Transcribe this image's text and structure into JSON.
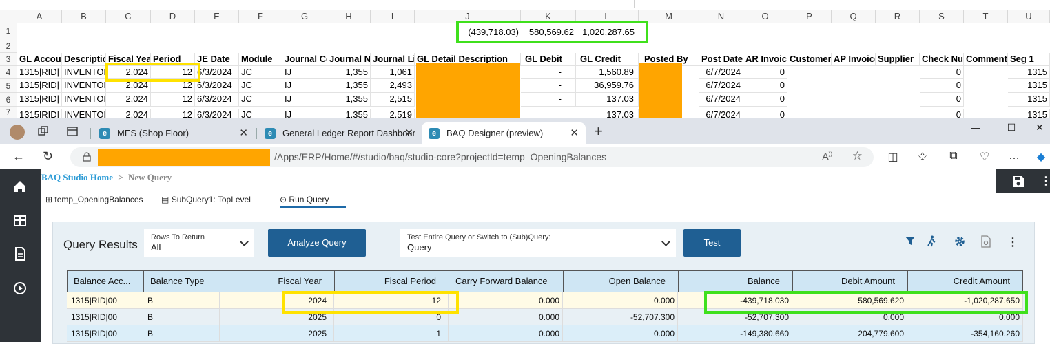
{
  "excel": {
    "columns": [
      "A",
      "B",
      "C",
      "D",
      "E",
      "F",
      "G",
      "H",
      "I",
      "J",
      "K",
      "L",
      "M",
      "N",
      "O",
      "P",
      "Q",
      "R",
      "S",
      "T",
      "U"
    ],
    "rows": [
      "1",
      "2",
      "3",
      "4",
      "5",
      "6",
      "7"
    ],
    "totals": {
      "J": "(439,718.03)",
      "K": "580,569.62",
      "L": "1,020,287.65"
    },
    "headers": [
      "GL Accoun",
      "Descriptio",
      "Fiscal Year",
      "Period",
      "JE Date",
      "Module",
      "Journal Co",
      "Journal Nu",
      "Journal Lin",
      "GL Detail Description",
      "GL Debit",
      "GL Credit",
      "Posted By",
      "Post Date",
      "AR Invoice",
      "Customer",
      "AP Invoice",
      "Supplier",
      "Check Nu",
      "Comment",
      "Seg 1"
    ],
    "data": [
      {
        "a": "1315|RID|",
        "b": "INVENTOR",
        "c": "2,024",
        "d": "12",
        "e": "6/3/2024",
        "f": "JC",
        "g": "IJ",
        "h": "1,355",
        "i": "1,061",
        "k": "-",
        "l": "1,560.89",
        "n": "6/7/2024",
        "o": "0",
        "s": "0",
        "u": "1315"
      },
      {
        "a": "1315|RID|",
        "b": "INVENTOR",
        "c": "2,024",
        "d": "12",
        "e": "6/3/2024",
        "f": "JC",
        "g": "IJ",
        "h": "1,355",
        "i": "2,493",
        "k": "-",
        "l": "36,959.76",
        "n": "6/7/2024",
        "o": "0",
        "s": "0",
        "u": "1315"
      },
      {
        "a": "1315|RID|",
        "b": "INVENTOR",
        "c": "2,024",
        "d": "12",
        "e": "6/3/2024",
        "f": "JC",
        "g": "IJ",
        "h": "1,355",
        "i": "2,515",
        "k": "-",
        "l": "137.03",
        "n": "6/7/2024",
        "o": "0",
        "s": "0",
        "u": "1315"
      },
      {
        "a": "1315|RID|",
        "b": "INVENTOF",
        "c": "2,024",
        "d": "12",
        "e": "6/3/2024",
        "f": "JC",
        "g": "IJ",
        "h": "1,355",
        "i": "2,519",
        "k": "",
        "l": "137.03",
        "n": "6/7/2024",
        "o": "0",
        "s": "0",
        "u": "1315"
      }
    ]
  },
  "browser": {
    "tabs": [
      {
        "label": "MES (Shop Floor)",
        "fav": "e"
      },
      {
        "label": "General Ledger Report Dashboar",
        "fav": "e"
      },
      {
        "label": "BAQ Designer (preview)",
        "fav": "e"
      }
    ],
    "new_tab": "+",
    "url": "/Apps/ERP/Home/#/studio/baq/studio-core?projectId=temp_OpeningBalances"
  },
  "app": {
    "breadcrumb_home": "BAQ Studio Home",
    "breadcrumb_sep": ">",
    "breadcrumb_current": "New Query",
    "subtabs": [
      "temp_OpeningBalances",
      "SubQuery1: TopLevel",
      "Run Query"
    ],
    "panel": {
      "title": "Query Results",
      "rows_label": "Rows To Return",
      "rows_value": "All",
      "analyze": "Analyze Query",
      "test_label": "Test Entire Query or Switch to (Sub)Query:",
      "test_value": "Query",
      "test_btn": "Test"
    },
    "grid": {
      "headers": [
        "Balance Acc...",
        "Balance Type",
        "Fiscal Year",
        "Fiscal Period",
        "Carry Forward Balance",
        "Open Balance",
        "Balance",
        "Debit Amount",
        "Credit Amount"
      ],
      "rows": [
        [
          "1315|RID|00",
          "B",
          "2024",
          "12",
          "0.000",
          "0.000",
          "-439,718.030",
          "580,569.620",
          "-1,020,287.650"
        ],
        [
          "1315|RID|00",
          "B",
          "2025",
          "0",
          "0.000",
          "-52,707.300",
          "-52,707.300",
          "0.000",
          "0.000"
        ],
        [
          "1315|RID|00",
          "B",
          "2025",
          "1",
          "0.000",
          "0.000",
          "-149,380.660",
          "204,779.600",
          "-354,160.260"
        ]
      ]
    }
  }
}
